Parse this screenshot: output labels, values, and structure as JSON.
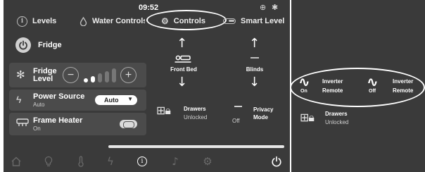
{
  "status_bar": {
    "time": "09:52",
    "globe_icon": "globe-icon",
    "bluetooth_icon": "bluetooth-icon"
  },
  "tabs": [
    {
      "label": "Levels",
      "icon": "info-circle-icon"
    },
    {
      "label": "Water Controls",
      "icon": "water-drop-icon"
    },
    {
      "label": "Controls",
      "icon": "gears-icon",
      "selected": true
    },
    {
      "label": "Smart Level",
      "icon": "switch-icon"
    }
  ],
  "fridge": {
    "power_label": "Fridge",
    "level_title_line1": "Fridge",
    "level_title_line2": "Level",
    "level_value": 2,
    "level_max": 5
  },
  "power_source": {
    "title": "Power Source",
    "subtitle": "Auto",
    "selected": "Auto"
  },
  "frame_heater": {
    "title": "Frame Heater",
    "subtitle": "On",
    "state": "on"
  },
  "front_bed": {
    "label": "Front Bed"
  },
  "blinds": {
    "label": "Blinds"
  },
  "drawers": {
    "title": "Drawers",
    "status": "Unlocked"
  },
  "privacy_mode": {
    "line1": "Privacy",
    "line2": "Mode",
    "state": "Off"
  },
  "bottom_nav": [
    {
      "name": "home-icon",
      "active": false
    },
    {
      "name": "lightbulb-icon",
      "active": false
    },
    {
      "name": "thermometer-icon",
      "active": false
    },
    {
      "name": "lightning-icon",
      "active": false
    },
    {
      "name": "info-icon",
      "active": true
    },
    {
      "name": "music-icon",
      "active": false
    },
    {
      "name": "settings-icon",
      "active": false
    },
    {
      "name": "power-icon",
      "active": true
    }
  ],
  "inverters": [
    {
      "state": "On",
      "line1": "Inverter",
      "line2": "Remote"
    },
    {
      "state": "Off",
      "line1": "Inverter",
      "line2": "Remote"
    }
  ],
  "right_drawers": {
    "title": "Drawers",
    "status": "Unlocked"
  },
  "colors": {
    "panel_bg": "#3a3a3a",
    "card_bg": "#4b4b4b",
    "text": "#ffffff",
    "inactive_icon": "#6a6a6a"
  }
}
